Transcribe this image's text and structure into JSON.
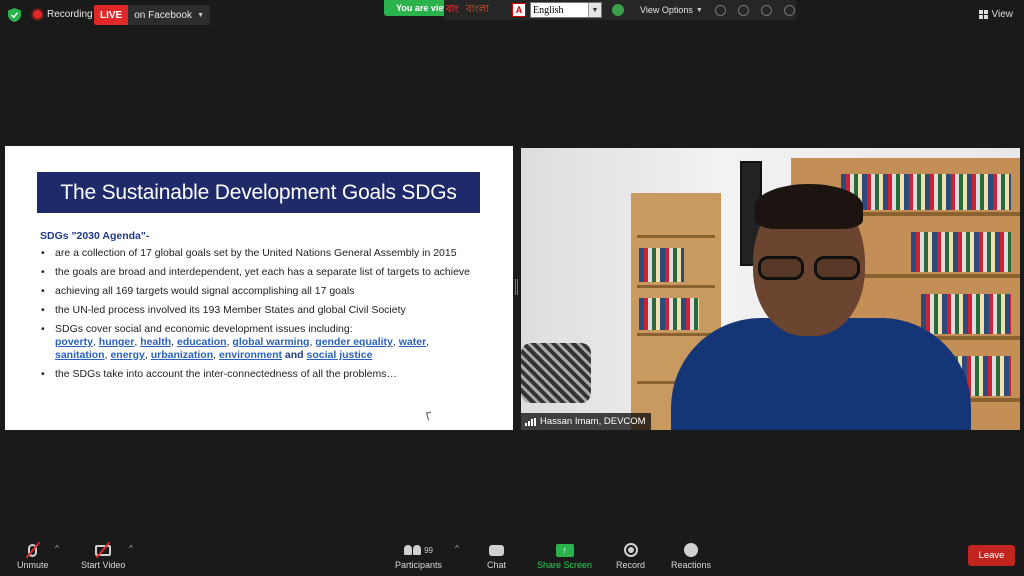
{
  "topbar": {
    "recording_label": "Recording",
    "live_label": "LIVE",
    "live_destination": "on Facebook",
    "viewing_banner": "You are viewing",
    "bangla_logo": "বাং",
    "bangla_text": "বাংলা",
    "language_icon_letter": "A",
    "language_select_value": "English",
    "view_options_label": "View Options",
    "view_label": "View"
  },
  "slide": {
    "title": "The Sustainable Development Goals SDGs",
    "subtitle": "SDGs \"2030 Agenda\"-",
    "bullets": [
      "are a collection of 17 global goals set by the United Nations General Assembly in 2015",
      "the goals are broad and interdependent, yet each has a separate list of targets to achieve",
      "achieving all 169 targets would signal accomplishing all 17 goals",
      "the UN-led process involved its 193 Member States and global Civil Society",
      "SDGs cover social and economic development issues including:",
      "the SDGs take into account the inter-connectedness of all the problems…"
    ],
    "keywords": [
      "poverty",
      "hunger",
      "health",
      "education",
      "global warming",
      "gender equality",
      "water",
      "sanitation",
      "energy",
      "urbanization",
      "environment",
      "social justice"
    ],
    "and_word": "and"
  },
  "video": {
    "participant_name": "Hassan Imam, DEVCOM"
  },
  "toolbar": {
    "unmute": "Unmute",
    "start_video": "Start Video",
    "participants": "Participants",
    "participants_count": "99",
    "chat": "Chat",
    "share_screen": "Share Screen",
    "record": "Record",
    "reactions": "Reactions",
    "leave": "Leave"
  },
  "colors": {
    "live_red": "#e02828",
    "share_green": "#2bb24c",
    "leave_red": "#c2241f",
    "slide_title_bg": "#1f2a6b",
    "keyword_blue": "#2a63b8"
  }
}
